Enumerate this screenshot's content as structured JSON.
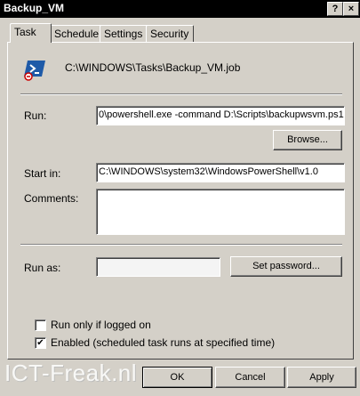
{
  "window": {
    "title": "Backup_VM",
    "help_label": "?",
    "close_label": "×"
  },
  "tabs": [
    "Task",
    "Schedule",
    "Settings",
    "Security"
  ],
  "task": {
    "path": "C:\\WINDOWS\\Tasks\\Backup_VM.job",
    "run_label": "Run:",
    "run_value": "0\\powershell.exe -command D:\\Scripts\\backupwsvm.ps1",
    "browse_label": "Browse...",
    "start_in_label": "Start in:",
    "start_in_value": "C:\\WINDOWS\\system32\\WindowsPowerShell\\v1.0",
    "comments_label": "Comments:",
    "comments_value": "",
    "run_as_label": "Run as:",
    "run_as_value": "",
    "set_password_label": "Set password...",
    "run_only_logged_on_label": "Run only if logged on",
    "run_only_logged_on_checked": false,
    "enabled_label": "Enabled (scheduled task runs at specified time)",
    "enabled_checked": true,
    "check_mark": "✔"
  },
  "footer": {
    "watermark": "ICT-Freak.nl",
    "ok_label": "OK",
    "cancel_label": "Cancel",
    "apply_label": "Apply"
  },
  "icons": {
    "task_icon": "powershell-icon"
  },
  "colors": {
    "titlebar": "#000000",
    "dialog": "#d4d0c8",
    "powershell_blue": "#1e5aa8"
  }
}
